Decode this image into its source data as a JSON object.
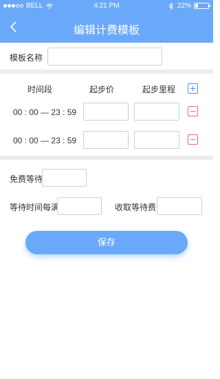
{
  "status_bar": {
    "carrier": "BELL",
    "time": "4:21 PM",
    "battery": "22%",
    "battery_level": 0.22,
    "signal_dots_filled": 3,
    "signal_dots_total": 5
  },
  "nav": {
    "title": "编辑计费模板",
    "back_icon": "chevron-left-icon"
  },
  "template": {
    "name_label": "模板名称",
    "name_value": "",
    "name_placeholder": ""
  },
  "pricing": {
    "headers": {
      "time_period": "时间段",
      "start_price": "起步价",
      "start_distance": "起步里程"
    },
    "add_icon": "plus-square-icon",
    "remove_icon": "minus-square-icon",
    "rows": [
      {
        "start": "00 : 00",
        "sep": "—",
        "end": "23 : 59",
        "price": "",
        "distance": ""
      },
      {
        "start": "00 : 00",
        "sep": "—",
        "end": "23 : 59",
        "price": "",
        "distance": ""
      }
    ]
  },
  "waiting": {
    "free_wait_label": "免费等待",
    "free_wait_value": "",
    "interval_label": "等待时间每满",
    "interval_value": "",
    "fee_label": "收取等待费",
    "fee_value": ""
  },
  "actions": {
    "save_label": "保存"
  },
  "colors": {
    "accent": "#6aa9f9",
    "add": "#4f8ff0",
    "remove": "#e86b6b",
    "divider": "#ececec"
  }
}
